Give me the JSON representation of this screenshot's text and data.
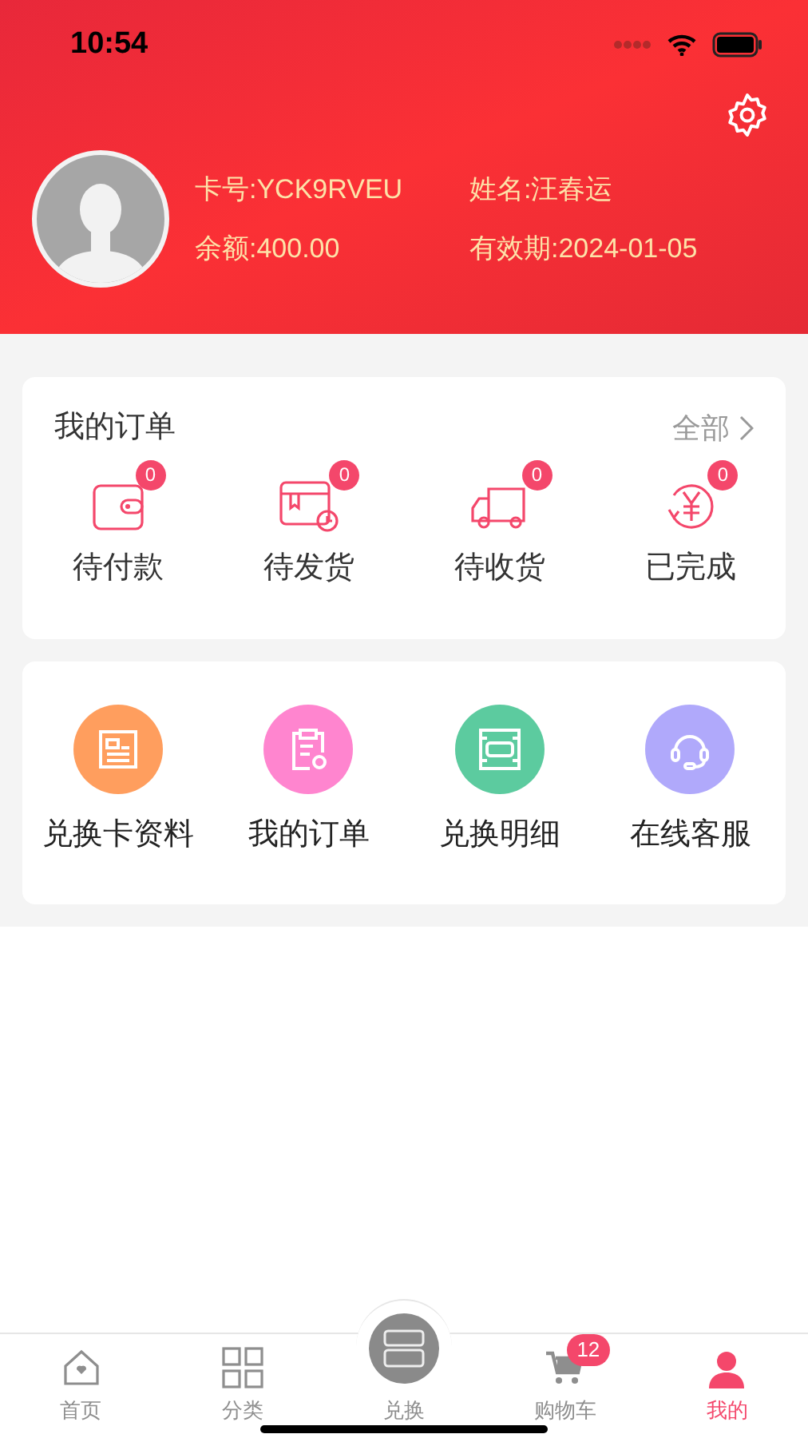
{
  "status_bar": {
    "time": "10:54"
  },
  "profile": {
    "card_no": "卡号:YCK9RVEU",
    "name": "姓名:汪春运",
    "balance": "余额:400.00",
    "expiry": "有效期:2024-01-05"
  },
  "orders": {
    "title": "我的订单",
    "all_link": "全部",
    "items": [
      {
        "kind": "wallet",
        "label": "待付款",
        "count": "0"
      },
      {
        "kind": "box",
        "label": "待发货",
        "count": "0"
      },
      {
        "kind": "truck",
        "label": "待收货",
        "count": "0"
      },
      {
        "kind": "done",
        "label": "已完成",
        "count": "0"
      }
    ]
  },
  "services": [
    {
      "kind": "card",
      "label": "兑换卡资料",
      "color": "#ff9e5e"
    },
    {
      "kind": "clipboard",
      "label": "我的订单",
      "color": "#ff85cf"
    },
    {
      "kind": "pay",
      "label": "兑换明细",
      "color": "#5ccb9f"
    },
    {
      "kind": "headset",
      "label": "在线客服",
      "color": "#b0a9fb"
    }
  ],
  "tab_bar": [
    {
      "kind": "home",
      "label": "首页",
      "selected": false
    },
    {
      "kind": "grid",
      "label": "分类",
      "selected": false
    },
    {
      "kind": "exchange",
      "label": "兑换",
      "selected": false
    },
    {
      "kind": "cart",
      "label": "购物车",
      "selected": false,
      "badge": "12"
    },
    {
      "kind": "user",
      "label": "我的",
      "selected": true
    }
  ]
}
